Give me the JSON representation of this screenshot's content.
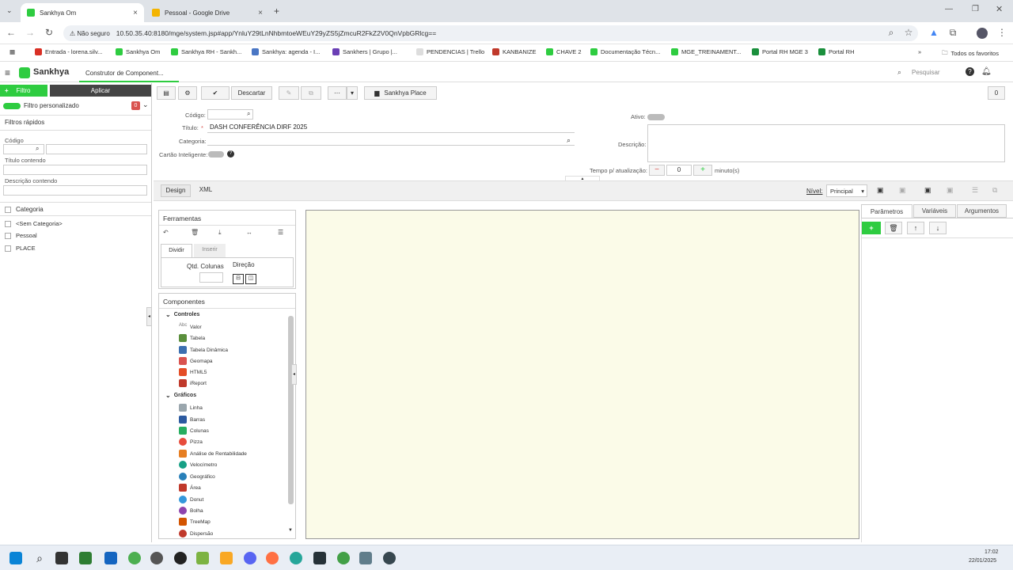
{
  "browser": {
    "tabs": [
      {
        "title": "Sankhya Om",
        "close": "×"
      },
      {
        "title": "Pessoal - Google Drive",
        "close": "×"
      }
    ],
    "new_tab": "+",
    "security_label": "Não seguro",
    "url": "10.50.35.40:8180/mge/system.jsp#app/YnluY29tLnNhbmtoeWEuY29yZS5jZmcuR2FkZ2V0QnVpbGRlcg==",
    "bookmarks": [
      "Entrada - lorena.silv...",
      "Sankhya Om",
      "Sankhya RH - Sankh...",
      "Sankhya: agenda - I...",
      "Sankhers | Grupo |...",
      "PENDENCIAS | Trello",
      "KANBANIZE",
      "CHAVE 2",
      "Documentação Técn...",
      "MGE_TREINAMENT...",
      "Portal RH MGE 3",
      "Portal RH"
    ],
    "all_bookmarks": "Todos os favoritos"
  },
  "app": {
    "brand": "Sankhya",
    "screen_title": "Construtor de Component...",
    "search_placeholder": "Pesquisar"
  },
  "left": {
    "filter_btn": "Filtro",
    "apply_btn": "Aplicar",
    "custom_filter": "Filtro personalizado",
    "custom_filter_count": "0",
    "quick_filters": "Filtros rápidos",
    "code_label": "Código",
    "title_contains": "Título contendo",
    "desc_contains": "Descrição contendo",
    "category_header": "Categoria",
    "categories": [
      "<Sem Categoria>",
      "Pessoal",
      "PLACE"
    ]
  },
  "toolbar": {
    "discard": "Descartar",
    "place": "Sankhya Place",
    "counter": "0"
  },
  "form": {
    "code_label": "Código:",
    "title_label": "Título:",
    "required_mark": "*",
    "title_value": "DASH CONFERÊNCIA DIRF 2025",
    "category_label": "Categoria:",
    "smart_card_label": "Cartão Inteligente:",
    "active_label": "Ativo:",
    "description_label": "Descrição:",
    "refresh_label": "Tempo p/ atualização:",
    "refresh_value": "0",
    "refresh_unit": "minuto(s)"
  },
  "designer": {
    "tab_design": "Design",
    "tab_xml": "XML",
    "level_label": "Nível:",
    "level_value": "Principal",
    "tools_header": "Ferramentas",
    "split_tab": "Dividir",
    "insert_tab": "Inserir",
    "qty_label": "Qtd. Colunas",
    "direction_label": "Direção",
    "components_header": "Componentes",
    "groups": [
      {
        "name": "Controles",
        "items": [
          {
            "label": "Valor",
            "color": "#999999"
          },
          {
            "label": "Tabela",
            "color": "#5a8f3c"
          },
          {
            "label": "Tabela Dinâmica",
            "color": "#3c6fb0"
          },
          {
            "label": "Geomapa",
            "color": "#d9534f"
          },
          {
            "label": "HTML5",
            "color": "#e44d26"
          },
          {
            "label": "iReport",
            "color": "#c0392b"
          }
        ]
      },
      {
        "name": "Gráficos",
        "items": [
          {
            "label": "Linha",
            "color": "#7f8c8d"
          },
          {
            "label": "Barras",
            "color": "#2c5aa0"
          },
          {
            "label": "Colunas",
            "color": "#27ae60"
          },
          {
            "label": "Pizza",
            "color": "#e74c3c"
          },
          {
            "label": "Análise de Rentabilidade",
            "color": "#e67e22"
          },
          {
            "label": "Velocímetro",
            "color": "#16a085"
          },
          {
            "label": "Geográfico",
            "color": "#2980b9"
          },
          {
            "label": "Área",
            "color": "#c0392b"
          },
          {
            "label": "Donut",
            "color": "#3498db"
          },
          {
            "label": "Bolha",
            "color": "#8e44ad"
          },
          {
            "label": "TreeMap",
            "color": "#d35400"
          },
          {
            "label": "Dispersão",
            "color": "#c0392b"
          }
        ]
      }
    ],
    "right_tabs": [
      "Parâmetros",
      "Variáveis",
      "Argumentos"
    ],
    "canvas_color": "#fbfbe8"
  },
  "taskbar": {
    "time": "17:02",
    "date": "22/01/2025"
  }
}
